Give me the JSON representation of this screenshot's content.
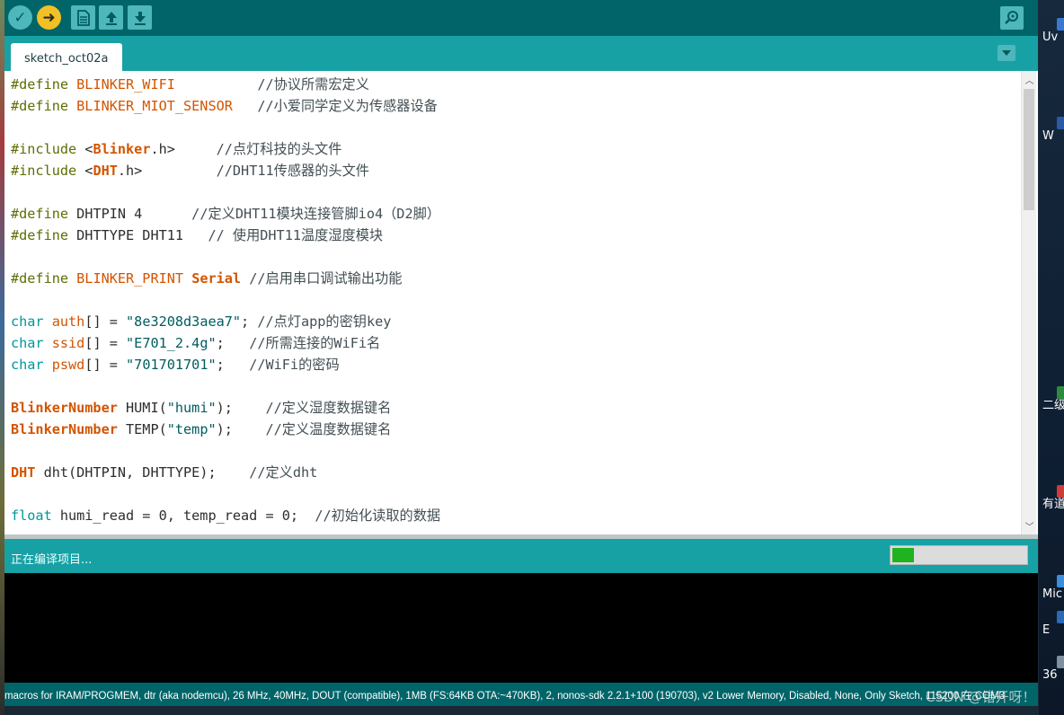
{
  "toolbar": {
    "buttons": [
      {
        "name": "verify-button",
        "icon": "check-icon",
        "glyph": "✓"
      },
      {
        "name": "upload-button",
        "icon": "arrow-right-icon",
        "glyph": "➜"
      },
      {
        "name": "new-button",
        "icon": "new-file-icon"
      },
      {
        "name": "open-button",
        "icon": "arrow-up-icon"
      },
      {
        "name": "save-button",
        "icon": "arrow-down-icon"
      }
    ],
    "serial_monitor_icon": "magnifier-icon"
  },
  "tabs": {
    "active_tab": "sketch_oct02a",
    "menu_icon": "chevron-down-icon"
  },
  "editor": {
    "lines": [
      [
        [
          "pre",
          "#define "
        ],
        [
          "macro",
          "BLINKER_WIFI"
        ],
        [
          "n",
          "          "
        ],
        [
          "cm",
          "//协议所需宏定义"
        ]
      ],
      [
        [
          "pre",
          "#define "
        ],
        [
          "macro",
          "BLINKER_MIOT_SENSOR"
        ],
        [
          "n",
          "   "
        ],
        [
          "cm",
          "//小爱同学定义为传感器设备"
        ]
      ],
      [],
      [
        [
          "pre",
          "#include "
        ],
        [
          "n",
          "<"
        ],
        [
          "cls",
          "Blinker"
        ],
        [
          "n",
          ".h>     "
        ],
        [
          "cm",
          "//点灯科技的头文件"
        ]
      ],
      [
        [
          "pre",
          "#include "
        ],
        [
          "n",
          "<"
        ],
        [
          "cls",
          "DHT"
        ],
        [
          "n",
          ".h>         "
        ],
        [
          "cm",
          "//DHT11传感器的头文件"
        ]
      ],
      [],
      [
        [
          "pre",
          "#define "
        ],
        [
          "n",
          "DHTPIN 4      "
        ],
        [
          "cm",
          "//定义DHT11模块连接管脚io4（D2脚）"
        ]
      ],
      [
        [
          "pre",
          "#define "
        ],
        [
          "n",
          "DHTTYPE DHT11   "
        ],
        [
          "cm",
          "// 使用DHT11温度湿度模块"
        ]
      ],
      [],
      [
        [
          "pre",
          "#define "
        ],
        [
          "macro",
          "BLINKER_PRINT"
        ],
        [
          "n",
          " "
        ],
        [
          "cls",
          "Serial"
        ],
        [
          "n",
          " "
        ],
        [
          "cm",
          "//启用串口调试输出功能"
        ]
      ],
      [],
      [
        [
          "type",
          "char"
        ],
        [
          "n",
          " "
        ],
        [
          "macro",
          "auth"
        ],
        [
          "n",
          "[] = "
        ],
        [
          "str",
          "\"8e3208d3aea7\""
        ],
        [
          "n",
          "; "
        ],
        [
          "cm",
          "//点灯app的密钥key"
        ]
      ],
      [
        [
          "type",
          "char"
        ],
        [
          "n",
          " "
        ],
        [
          "macro",
          "ssid"
        ],
        [
          "n",
          "[] = "
        ],
        [
          "str",
          "\"E701_2.4g\""
        ],
        [
          "n",
          ";   "
        ],
        [
          "cm",
          "//所需连接的WiFi名"
        ]
      ],
      [
        [
          "type",
          "char"
        ],
        [
          "n",
          " "
        ],
        [
          "macro",
          "pswd"
        ],
        [
          "n",
          "[] = "
        ],
        [
          "str",
          "\"701701701\""
        ],
        [
          "n",
          ";   "
        ],
        [
          "cm",
          "//WiFi的密码"
        ]
      ],
      [],
      [
        [
          "cls",
          "BlinkerNumber"
        ],
        [
          "n",
          " HUMI("
        ],
        [
          "str",
          "\"humi\""
        ],
        [
          "n",
          ");    "
        ],
        [
          "cm",
          "//定义湿度数据键名"
        ]
      ],
      [
        [
          "cls",
          "BlinkerNumber"
        ],
        [
          "n",
          " TEMP("
        ],
        [
          "str",
          "\"temp\""
        ],
        [
          "n",
          ");    "
        ],
        [
          "cm",
          "//定义温度数据键名"
        ]
      ],
      [],
      [
        [
          "cls",
          "DHT"
        ],
        [
          "n",
          " dht(DHTPIN, DHTTYPE);    "
        ],
        [
          "cm",
          "//定义dht"
        ]
      ],
      [],
      [
        [
          "type",
          "float"
        ],
        [
          "n",
          " humi_read = 0, temp_read = 0;  "
        ],
        [
          "cm",
          "//初始化读取的数据"
        ]
      ]
    ]
  },
  "status": {
    "message": "正在编译项目...",
    "progress_fraction": 0.16
  },
  "board_info": "macros for IRAM/PROGMEM, dtr (aka nodemcu), 26 MHz, 40MHz, DOUT (compatible), 1MB (FS:64KB OTA:~470KB), 2, nonos-sdk 2.2.1+100 (190703), v2 Lower Memory, Disabled, None, Only Sketch, 115200 在 COM3",
  "watermark": "CSDN @错开呀！",
  "desktop": {
    "items": [
      {
        "label": "Uv",
        "color": "#3a78d0"
      },
      {
        "label": "W",
        "color": "#2a5aa8"
      },
      {
        "label": "二级",
        "color": "#2c8c3c"
      },
      {
        "label": "有道",
        "color": "#d03a3a"
      },
      {
        "label": "Mic",
        "color": "#3a90e0"
      },
      {
        "label": "E",
        "color": "#2a6ab8"
      },
      {
        "label": "36",
        "color": "#8090a0"
      }
    ]
  }
}
